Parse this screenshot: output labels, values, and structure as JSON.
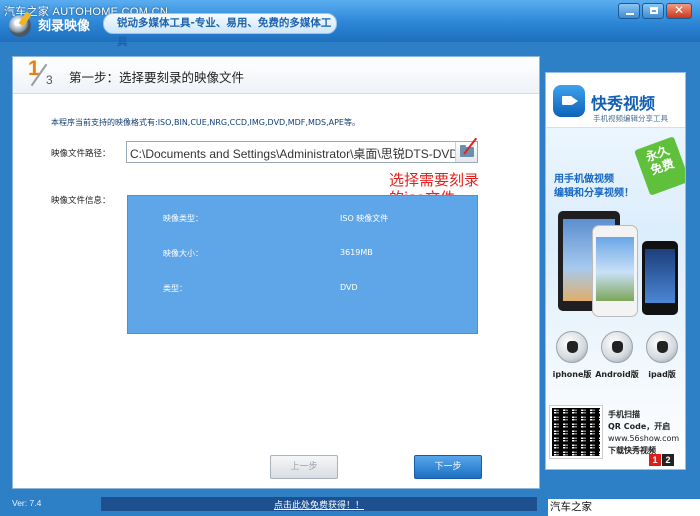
{
  "watermark": {
    "top": "汽车之家 AUTOHOME.COM.CN",
    "bottom": "汽车之家  AUTOHOME.COM.CN"
  },
  "app": {
    "title": "刻录映像",
    "tagline": "锐动多媒体工具-专业、易用、免费的多媒体工具"
  },
  "step": {
    "current": "1",
    "total": "3",
    "title": "第一步：选择要刻录的映像文件"
  },
  "formats_text": "本程序当前支持的映像格式有:ISO,BIN,CUE,NRG,CCD,IMG,DVD,MDF,MDS,APE等。",
  "path": {
    "label": "映像文件路径：",
    "value": "C:\\Documents and Settings\\Administrator\\桌面\\思锐DTS-DVD"
  },
  "annotation": {
    "line1": "选择需要刻录",
    "line2": "的iso文件"
  },
  "info": {
    "label": "映像文件信息：",
    "rows": [
      {
        "key": "映像类型：",
        "value": "ISO 映像文件"
      },
      {
        "key": "映像大小：",
        "value": "3619MB"
      },
      {
        "key": "类型：",
        "value": "DVD"
      }
    ]
  },
  "buttons": {
    "prev": "上一步",
    "next": "下一步"
  },
  "ad": {
    "brand": "快秀视频",
    "subtitle": "手机视频编辑分享工具",
    "slogan_line1": "用手机做视频",
    "slogan_line2": "编辑和分享视频！",
    "badge_line1": "永久",
    "badge_line2": "免费",
    "platforms": [
      "iphone版",
      "Android版",
      "ipad版"
    ],
    "qr_line1": "手机扫描",
    "qr_line2": "QR Code，开启",
    "qr_url": "www.56show.com",
    "qr_line4": "下载快秀视频",
    "pages": [
      "1",
      "2"
    ]
  },
  "status": {
    "version": "Ver: 7.4",
    "promo": "点击此处免费获得！！"
  }
}
